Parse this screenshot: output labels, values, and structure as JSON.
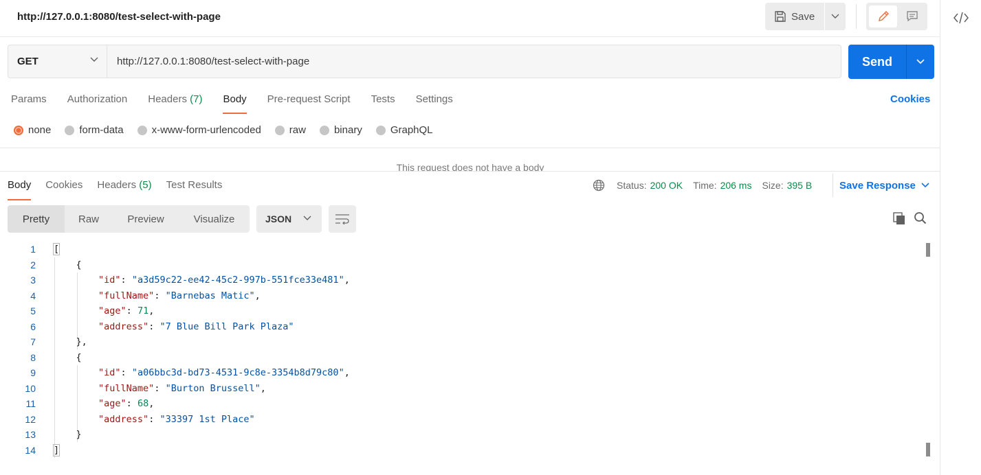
{
  "header": {
    "title": "http://127.0.0.1:8080/test-select-with-page",
    "save_label": "Save"
  },
  "request": {
    "method": "GET",
    "url": "http://127.0.0.1:8080/test-select-with-page",
    "send_label": "Send"
  },
  "request_tabs": {
    "params": "Params",
    "authorization": "Authorization",
    "headers": "Headers",
    "headers_count": "(7)",
    "body": "Body",
    "prerequest": "Pre-request Script",
    "tests": "Tests",
    "settings": "Settings",
    "cookies": "Cookies"
  },
  "body_types": {
    "none": "none",
    "form_data": "form-data",
    "urlencoded": "x-www-form-urlencoded",
    "raw": "raw",
    "binary": "binary",
    "graphql": "GraphQL",
    "selected": "none"
  },
  "no_body_message": "This request does not have a body",
  "response_tabs": {
    "body": "Body",
    "cookies": "Cookies",
    "headers": "Headers",
    "headers_count": "(5)",
    "test_results": "Test Results"
  },
  "response_status": {
    "status_label": "Status:",
    "status_value": "200 OK",
    "time_label": "Time:",
    "time_value": "206 ms",
    "size_label": "Size:",
    "size_value": "395 B",
    "save_response": "Save Response"
  },
  "view_modes": {
    "pretty": "Pretty",
    "raw": "Raw",
    "preview": "Preview",
    "visualize": "Visualize",
    "format": "JSON"
  },
  "code_lines": [
    {
      "num": "1"
    },
    {
      "num": "2"
    },
    {
      "num": "3"
    },
    {
      "num": "4"
    },
    {
      "num": "5"
    },
    {
      "num": "6"
    },
    {
      "num": "7"
    },
    {
      "num": "8"
    },
    {
      "num": "9"
    },
    {
      "num": "10"
    },
    {
      "num": "11"
    },
    {
      "num": "12"
    },
    {
      "num": "13"
    },
    {
      "num": "14"
    }
  ],
  "response_json": [
    {
      "id": "a3d59c22-ee42-45c2-997b-551fce33e481",
      "fullName": "Barnebas Matic",
      "age": "71",
      "address": "7 Blue Bill Park Plaza"
    },
    {
      "id": "a06bbc3d-bd73-4531-9c8e-3354b8d79c80",
      "fullName": "Burton Brussell",
      "age": "68",
      "address": "33397 1st Place"
    }
  ],
  "colors": {
    "accent": "#f26b3a",
    "primary": "#0f72e5",
    "success": "#0f8a4a"
  }
}
